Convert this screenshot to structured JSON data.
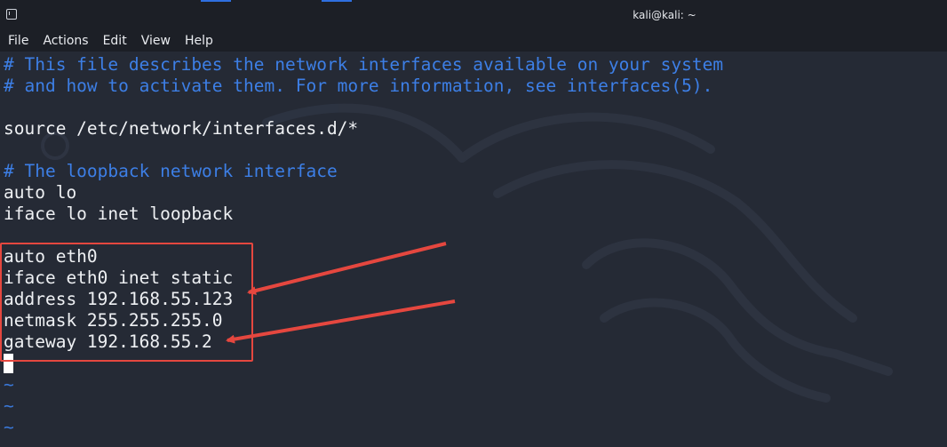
{
  "window": {
    "title": "kali@kali: ~"
  },
  "menu": {
    "items": [
      "File",
      "Actions",
      "Edit",
      "View",
      "Help"
    ]
  },
  "terminal": {
    "lines": [
      {
        "text": "# This file describes the network interfaces available on your system",
        "kind": "comment"
      },
      {
        "text": "# and how to activate them. For more information, see interfaces(5).",
        "kind": "comment"
      },
      {
        "text": "",
        "kind": "plain"
      },
      {
        "text": "source /etc/network/interfaces.d/*",
        "kind": "plain"
      },
      {
        "text": "",
        "kind": "plain"
      },
      {
        "text": "# The loopback network interface",
        "kind": "comment"
      },
      {
        "text": "auto lo",
        "kind": "plain"
      },
      {
        "text": "iface lo inet loopback",
        "kind": "plain"
      },
      {
        "text": "",
        "kind": "plain"
      },
      {
        "text": "auto eth0",
        "kind": "plain"
      },
      {
        "text": "iface eth0 inet static",
        "kind": "plain"
      },
      {
        "text": "address 192.168.55.123",
        "kind": "plain"
      },
      {
        "text": "netmask 255.255.255.0",
        "kind": "plain"
      },
      {
        "text": "gateway 192.168.55.2",
        "kind": "plain"
      },
      {
        "text": "",
        "kind": "cursor"
      },
      {
        "text": "~",
        "kind": "tilde"
      },
      {
        "text": "~",
        "kind": "tilde"
      },
      {
        "text": "~",
        "kind": "tilde"
      }
    ]
  },
  "colors": {
    "background": "#252a35",
    "titlebar": "#1c1f26",
    "comment": "#3d7fe6",
    "text": "#eef0f3",
    "annotation": "#e5473f"
  }
}
